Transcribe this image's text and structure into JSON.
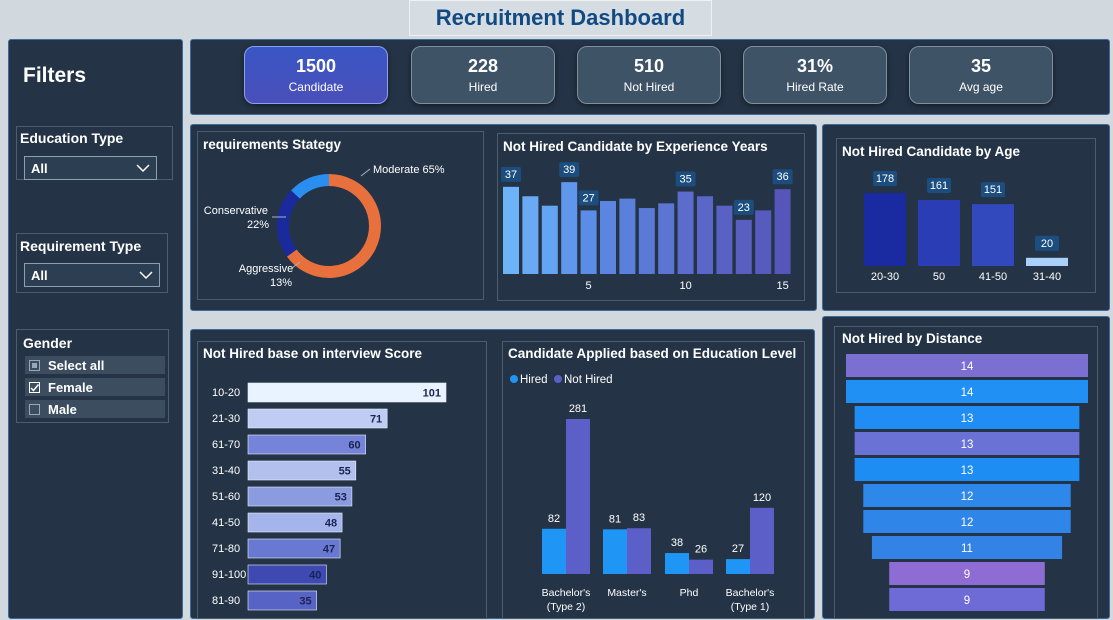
{
  "title": "Recruitment Dashboard",
  "filters": {
    "heading": "Filters",
    "education": {
      "label": "Education Type",
      "value": "All"
    },
    "requirement": {
      "label": "Requirement Type",
      "value": "All"
    },
    "gender": {
      "label": "Gender",
      "options": [
        {
          "label": "Select all",
          "state": "partial"
        },
        {
          "label": "Female",
          "state": "checked"
        },
        {
          "label": "Male",
          "state": "unchecked"
        }
      ]
    }
  },
  "kpis": [
    {
      "value": "1500",
      "label": "Candidate",
      "active": true
    },
    {
      "value": "228",
      "label": "Hired"
    },
    {
      "value": "510",
      "label": "Not Hired"
    },
    {
      "value": "31%",
      "label": "Hired Rate"
    },
    {
      "value": "35",
      "label": "Avg age"
    }
  ],
  "colors": {
    "accent": "#4a56c4",
    "panel": "#243446",
    "orange": "#e8703c",
    "navy": "#1a2a9c",
    "blue": "#2a8df0",
    "hired": "#1f96f5",
    "not_hired": "#5b5fc7"
  },
  "chart_data": [
    {
      "id": "strategy",
      "type": "pie",
      "title": "requirements Stategy",
      "slices": [
        {
          "name": "Moderate",
          "value": 65,
          "label": "Moderate 65%",
          "color": "#e8703c"
        },
        {
          "name": "Conservative",
          "value": 22,
          "label": "Conservative",
          "pct": "22%",
          "color": "#1a2a9c"
        },
        {
          "name": "Aggressive",
          "value": 13,
          "label": "Aggressive",
          "pct": "13%",
          "color": "#2a8df0"
        }
      ]
    },
    {
      "id": "experience",
      "type": "bar",
      "title": "Not Hired Candidate by Experience Years",
      "x": [
        1,
        2,
        3,
        4,
        5,
        6,
        7,
        8,
        9,
        10,
        11,
        12,
        13,
        14,
        15
      ],
      "values": [
        37,
        33,
        29,
        39,
        27,
        31,
        32,
        28,
        30,
        35,
        33,
        29,
        23,
        27,
        36
      ],
      "labeled": [
        1,
        4,
        5,
        10,
        13,
        15
      ],
      "xticks": [
        5,
        10,
        15
      ],
      "ylim": [
        0,
        45
      ]
    },
    {
      "id": "age",
      "type": "bar",
      "title": "Not Hired Candidate by Age",
      "categories": [
        "20-30",
        "50",
        "41-50",
        "31-40"
      ],
      "values": [
        178,
        161,
        151,
        20
      ],
      "colors": [
        "#1a2aa0",
        "#2a3db4",
        "#3149bc",
        "#a8d0fa"
      ],
      "ylim": [
        0,
        200
      ]
    },
    {
      "id": "interview",
      "type": "bar",
      "title": "Not Hired base on interview Score",
      "categories": [
        "10-20",
        "21-30",
        "61-70",
        "31-40",
        "51-60",
        "41-50",
        "71-80",
        "91-100",
        "81-90"
      ],
      "values": [
        101,
        71,
        60,
        55,
        53,
        48,
        47,
        40,
        35
      ],
      "colors": [
        "#e9f2ff",
        "#c1ccf2",
        "#7584d8",
        "#b2c0ee",
        "#8a9be0",
        "#a5b5ec",
        "#6979d2",
        "#3e49b2",
        "#5863c6"
      ],
      "xlim": [
        0,
        101
      ]
    },
    {
      "id": "education",
      "type": "bar",
      "title": "Candidate Applied based on Education Level",
      "categories": [
        "Bachelor's (Type 2)",
        "Master's",
        "Phd",
        "Bachelor's (Type 1)"
      ],
      "category_lines": [
        [
          "Bachelor's",
          "(Type 2)"
        ],
        [
          "Master's"
        ],
        [
          "Phd"
        ],
        [
          "Bachelor's",
          "(Type 1)"
        ]
      ],
      "series": [
        {
          "name": "Hired",
          "values": [
            82,
            81,
            38,
            27
          ],
          "color": "#1f96f5"
        },
        {
          "name": "Not Hired",
          "values": [
            281,
            83,
            26,
            120
          ],
          "color": "#5b5fc7"
        }
      ],
      "legend": "top-left",
      "ylim": [
        0,
        300
      ]
    },
    {
      "id": "distance",
      "type": "bar",
      "title": "Not Hired by Distance",
      "values": [
        14,
        14,
        13,
        13,
        13,
        12,
        12,
        11,
        9,
        9
      ],
      "colors": [
        "#7b6fd2",
        "#2190f5",
        "#1f8df4",
        "#6a72d6",
        "#1d8cf3",
        "#2d88ea",
        "#3086e8",
        "#3382e6",
        "#8f6cd4",
        "#6e6ad6"
      ],
      "xlim": [
        0,
        14
      ]
    }
  ]
}
